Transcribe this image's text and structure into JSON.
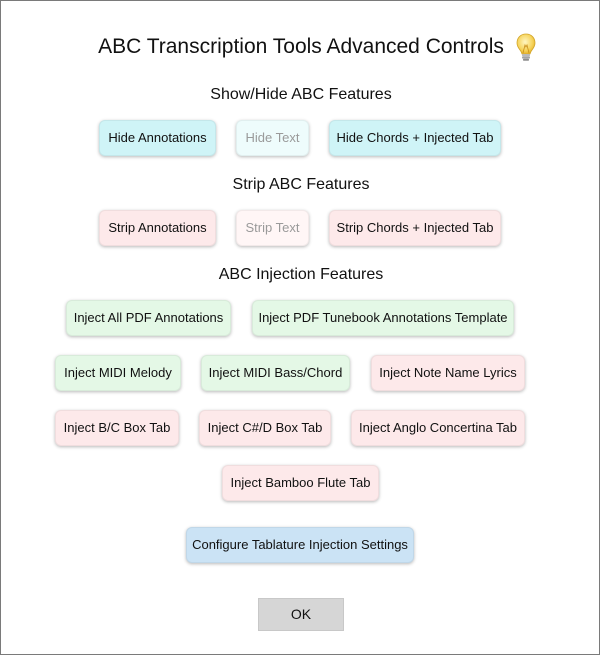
{
  "dialog": {
    "title": "ABC Transcription Tools Advanced Controls",
    "help_icon": "lightbulb-icon"
  },
  "show_hide": {
    "heading": "Show/Hide ABC Features",
    "hide_annotations": "Hide Annotations",
    "hide_text": "Hide Text",
    "hide_chords": "Hide Chords + Injected Tab"
  },
  "strip": {
    "heading": "Strip ABC Features",
    "strip_annotations": "Strip Annotations",
    "strip_text": "Strip Text",
    "strip_chords": "Strip Chords + Injected Tab"
  },
  "injection": {
    "heading": "ABC Injection Features",
    "inject_pdf_annotations": "Inject All PDF Annotations",
    "inject_pdf_template": "Inject PDF Tunebook Annotations Template",
    "inject_midi_melody": "Inject MIDI Melody",
    "inject_midi_bass": "Inject MIDI Bass/Chord",
    "inject_note_names": "Inject Note Name Lyrics",
    "inject_bc_box": "Inject B/C Box Tab",
    "inject_csd_box": "Inject C#/D Box Tab",
    "inject_anglo": "Inject Anglo Concertina Tab",
    "inject_flute": "Inject Bamboo Flute Tab"
  },
  "configure_label": "Configure Tablature Injection Settings",
  "ok_label": "OK",
  "colors": {
    "show_hide": "#cff4f7",
    "strip": "#fde9ea",
    "inject_green": "#e4f8e6",
    "inject_pink": "#fde9ea",
    "configure": "#cbe3f5",
    "ok": "#d6d6d6"
  }
}
